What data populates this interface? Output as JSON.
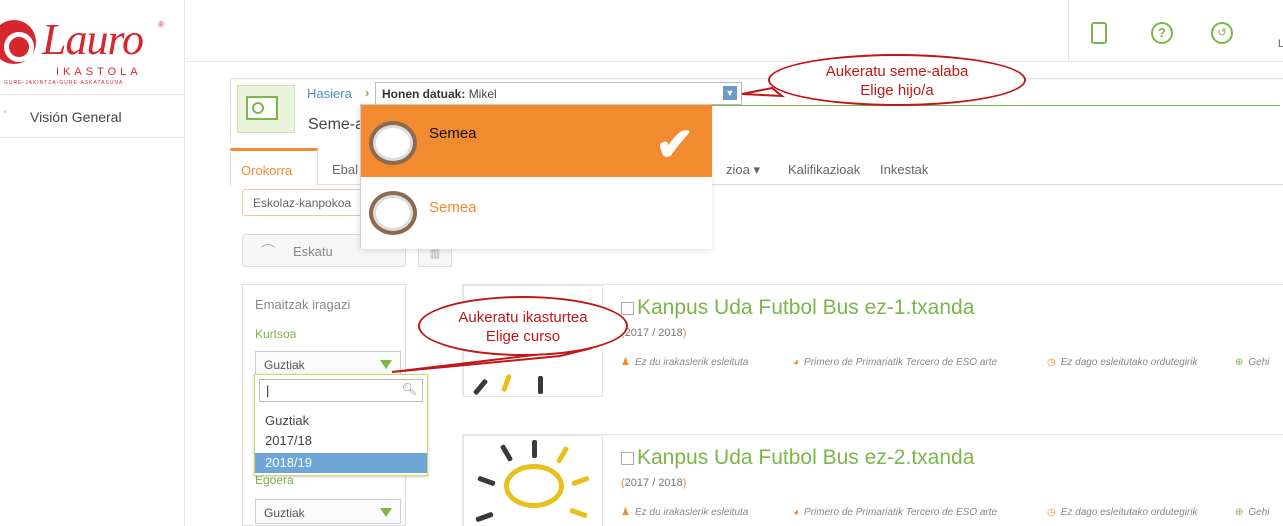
{
  "brand": {
    "word": "Lauro",
    "sub": "IKASTOLA",
    "tagline": "GURE-JAKINTZA-GURE-ASKATASUNA",
    "color": "#d6262e"
  },
  "sidebar": {
    "items": [
      {
        "label": "Visión General"
      }
    ]
  },
  "topbar": {
    "icons": [
      "mobile-icon",
      "help-icon",
      "history-icon"
    ],
    "user_initial": "L"
  },
  "header": {
    "breadcrumb_home": "Hasiera",
    "selector_label": "Honen datuak:",
    "selector_value": "Mikel",
    "title": "Seme-a"
  },
  "child_dropdown": {
    "options": [
      {
        "label": "Semea",
        "selected": true
      },
      {
        "label": "Semea",
        "selected": false
      }
    ]
  },
  "tabs": [
    {
      "label": "Orokorra",
      "active": true
    },
    {
      "label": "Ebal"
    },
    {
      "label": "zioa ▾"
    },
    {
      "label": "Kalifikazioak"
    },
    {
      "label": "Inkestak"
    }
  ],
  "actions": {
    "extra_button": "Eskolaz-kanpokoa",
    "ask_button": "Eskatu"
  },
  "filter": {
    "title": "Emaitzak iragazi",
    "kurtsoa_label": "Kurtsoa",
    "kurtsoa_value": "Guztiak",
    "egoera_label": "Egoera",
    "egoera_value": "Guztiak"
  },
  "year_dropdown": {
    "search_value": "|",
    "options": [
      "Guztiak",
      "2017/18",
      "2018/19"
    ],
    "highlighted": "2018/19"
  },
  "cards": [
    {
      "title": "Kanpus Uda Futbol Bus ez-1.txanda",
      "years_open": "(",
      "years": "2017 / 2018",
      "years_close": ")",
      "teacher": "Ez du irakaslerik esleituta",
      "level": "Primero de Primariatik Tercero de ESO arte",
      "schedule": "Ez dago esleitutako ordutegirik",
      "more": "Gehi"
    },
    {
      "title": "Kanpus Uda Futbol Bus ez-2.txanda",
      "years_open": "(",
      "years": "2017 / 2018",
      "years_close": ")",
      "teacher": "Ez du irakaslerik esleituta",
      "level": "Primero de Primariatik Tercero de ESO arte",
      "schedule": "Ez dago esleitutako ordutegirik",
      "more": "Gehi"
    }
  ],
  "callouts": {
    "child_line1": "Aukeratu seme-alaba",
    "child_line2": "Elige hijo/a",
    "year_line1": "Aukeratu ikasturtea",
    "year_line2": "Elige curso"
  },
  "colors": {
    "accent_green": "#7ab648",
    "accent_orange": "#f28b2f",
    "callout_red": "#c01818",
    "link_blue": "#4a90c2"
  }
}
